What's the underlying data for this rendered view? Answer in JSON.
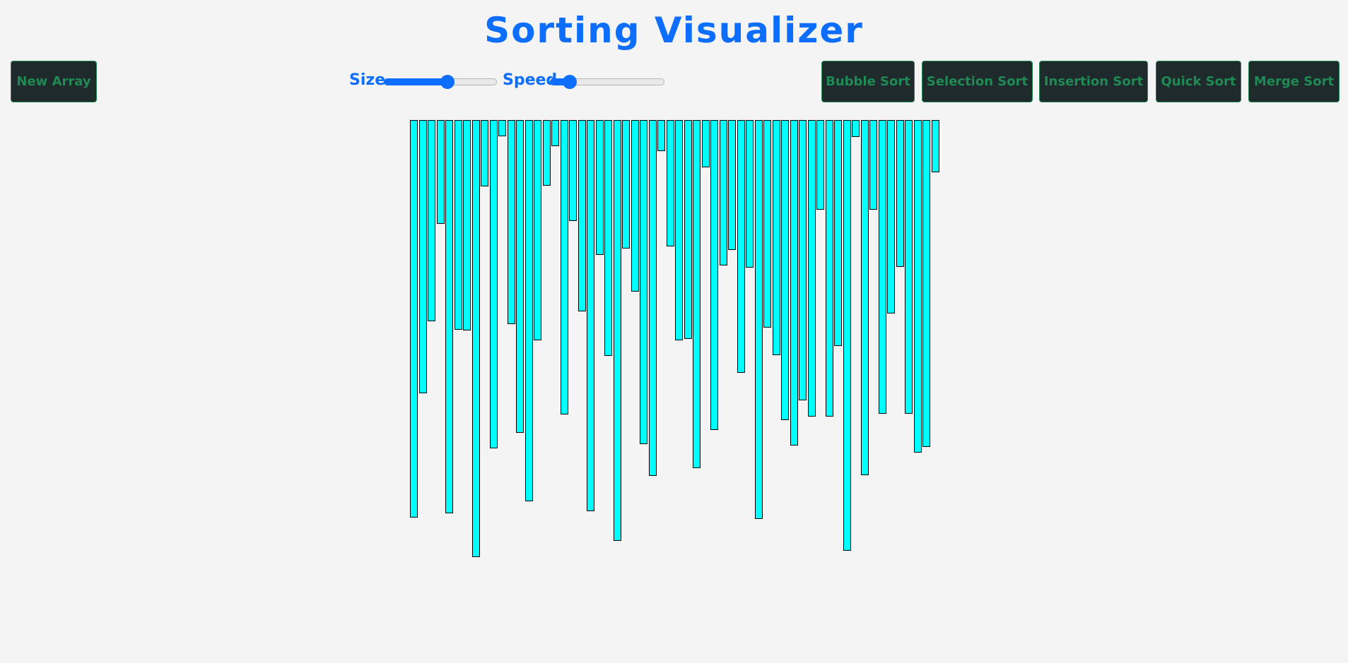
{
  "header": {
    "title": "Sorting Visualizer"
  },
  "colors": {
    "accent": "#0d6efd",
    "button_text": "#1f8a53",
    "button_bg": "#1f2a2c",
    "bar": "#00ffff"
  },
  "controls": {
    "new_array_label": "New Array",
    "size": {
      "label": "Size",
      "value": 0.57
    },
    "speed": {
      "label": "Speed",
      "value": 0.13
    }
  },
  "algorithms": [
    "Bubble Sort",
    "Selection Sort",
    "Insertion Sort",
    "Quick Sort",
    "Merge Sort"
  ],
  "array_values": [
    563,
    387,
    285,
    147,
    557,
    297,
    298,
    619,
    94,
    465,
    23,
    289,
    443,
    540,
    312,
    93,
    37,
    417,
    143,
    271,
    554,
    191,
    334,
    596,
    182,
    243,
    459,
    504,
    44,
    179,
    312,
    310,
    493,
    67,
    439,
    206,
    184,
    358,
    209,
    565,
    294,
    333,
    425,
    461,
    397,
    420,
    127,
    420,
    320,
    610,
    24,
    503,
    127,
    416,
    274,
    208,
    416,
    471,
    463,
    74
  ]
}
